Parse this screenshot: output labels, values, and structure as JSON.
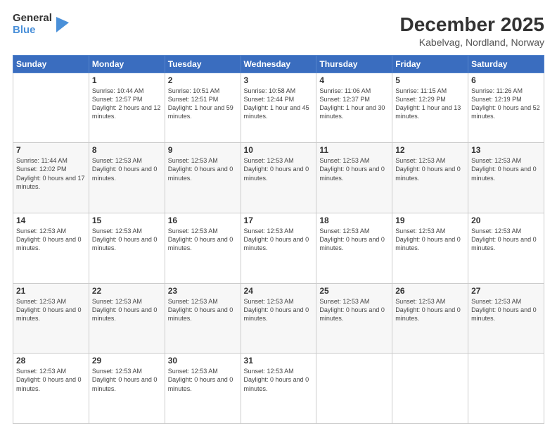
{
  "logo": {
    "line1": "General",
    "line2": "Blue"
  },
  "title": "December 2025",
  "subtitle": "Kabelvag, Nordland, Norway",
  "days_of_week": [
    "Sunday",
    "Monday",
    "Tuesday",
    "Wednesday",
    "Thursday",
    "Friday",
    "Saturday"
  ],
  "weeks": [
    [
      {
        "num": "",
        "info": ""
      },
      {
        "num": "1",
        "info": "Sunrise: 10:44 AM\nSunset: 12:57 PM\nDaylight: 2 hours and 12 minutes."
      },
      {
        "num": "2",
        "info": "Sunrise: 10:51 AM\nSunset: 12:51 PM\nDaylight: 1 hour and 59 minutes."
      },
      {
        "num": "3",
        "info": "Sunrise: 10:58 AM\nSunset: 12:44 PM\nDaylight: 1 hour and 45 minutes."
      },
      {
        "num": "4",
        "info": "Sunrise: 11:06 AM\nSunset: 12:37 PM\nDaylight: 1 hour and 30 minutes."
      },
      {
        "num": "5",
        "info": "Sunrise: 11:15 AM\nSunset: 12:29 PM\nDaylight: 1 hour and 13 minutes."
      },
      {
        "num": "6",
        "info": "Sunrise: 11:26 AM\nSunset: 12:19 PM\nDaylight: 0 hours and 52 minutes."
      }
    ],
    [
      {
        "num": "7",
        "info": "Sunrise: 11:44 AM\nSunset: 12:02 PM\nDaylight: 0 hours and 17 minutes."
      },
      {
        "num": "8",
        "info": "Sunset: 12:53 AM\nDaylight: 0 hours and 0 minutes."
      },
      {
        "num": "9",
        "info": "Sunset: 12:53 AM\nDaylight: 0 hours and 0 minutes."
      },
      {
        "num": "10",
        "info": "Sunset: 12:53 AM\nDaylight: 0 hours and 0 minutes."
      },
      {
        "num": "11",
        "info": "Sunset: 12:53 AM\nDaylight: 0 hours and 0 minutes."
      },
      {
        "num": "12",
        "info": "Sunset: 12:53 AM\nDaylight: 0 hours and 0 minutes."
      },
      {
        "num": "13",
        "info": "Sunset: 12:53 AM\nDaylight: 0 hours and 0 minutes."
      }
    ],
    [
      {
        "num": "14",
        "info": "Sunset: 12:53 AM\nDaylight: 0 hours and 0 minutes."
      },
      {
        "num": "15",
        "info": "Sunset: 12:53 AM\nDaylight: 0 hours and 0 minutes."
      },
      {
        "num": "16",
        "info": "Sunset: 12:53 AM\nDaylight: 0 hours and 0 minutes."
      },
      {
        "num": "17",
        "info": "Sunset: 12:53 AM\nDaylight: 0 hours and 0 minutes."
      },
      {
        "num": "18",
        "info": "Sunset: 12:53 AM\nDaylight: 0 hours and 0 minutes."
      },
      {
        "num": "19",
        "info": "Sunset: 12:53 AM\nDaylight: 0 hours and 0 minutes."
      },
      {
        "num": "20",
        "info": "Sunset: 12:53 AM\nDaylight: 0 hours and 0 minutes."
      }
    ],
    [
      {
        "num": "21",
        "info": "Sunset: 12:53 AM\nDaylight: 0 hours and 0 minutes."
      },
      {
        "num": "22",
        "info": "Sunset: 12:53 AM\nDaylight: 0 hours and 0 minutes."
      },
      {
        "num": "23",
        "info": "Sunset: 12:53 AM\nDaylight: 0 hours and 0 minutes."
      },
      {
        "num": "24",
        "info": "Sunset: 12:53 AM\nDaylight: 0 hours and 0 minutes."
      },
      {
        "num": "25",
        "info": "Sunset: 12:53 AM\nDaylight: 0 hours and 0 minutes."
      },
      {
        "num": "26",
        "info": "Sunset: 12:53 AM\nDaylight: 0 hours and 0 minutes."
      },
      {
        "num": "27",
        "info": "Sunset: 12:53 AM\nDaylight: 0 hours and 0 minutes."
      }
    ],
    [
      {
        "num": "28",
        "info": "Sunset: 12:53 AM\nDaylight: 0 hours and 0 minutes."
      },
      {
        "num": "29",
        "info": "Sunset: 12:53 AM\nDaylight: 0 hours and 0 minutes."
      },
      {
        "num": "30",
        "info": "Sunset: 12:53 AM\nDaylight: 0 hours and 0 minutes."
      },
      {
        "num": "31",
        "info": "Sunset: 12:53 AM\nDaylight: 0 hours and 0 minutes."
      },
      {
        "num": "",
        "info": ""
      },
      {
        "num": "",
        "info": ""
      },
      {
        "num": "",
        "info": ""
      }
    ]
  ]
}
